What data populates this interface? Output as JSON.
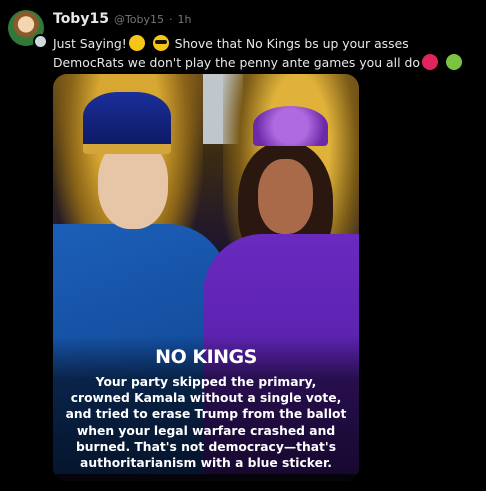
{
  "post": {
    "author_name": "Toby15",
    "author_handle": "@Toby15",
    "separator": "·",
    "time": "1h",
    "text_part1": "Just Saying!",
    "text_part2": "Shove that No Kings bs up your asses DemocRats we don't play the penny ante games you all do",
    "emojis": [
      "thinking-face-emoji",
      "sunglasses-emoji",
      "angry-face-emoji",
      "nauseated-face-emoji"
    ]
  },
  "media": {
    "headline": "NO KINGS",
    "body": "Your party skipped the primary, crowned Kamala without a single vote, and tried to erase Trump from the ballot when your legal warfare crashed and burned. That's not democracy—that's authoritarianism with a blue sticker."
  },
  "colors": {
    "background": "#000000",
    "text": "#e7e9ea",
    "muted": "#71767b"
  }
}
